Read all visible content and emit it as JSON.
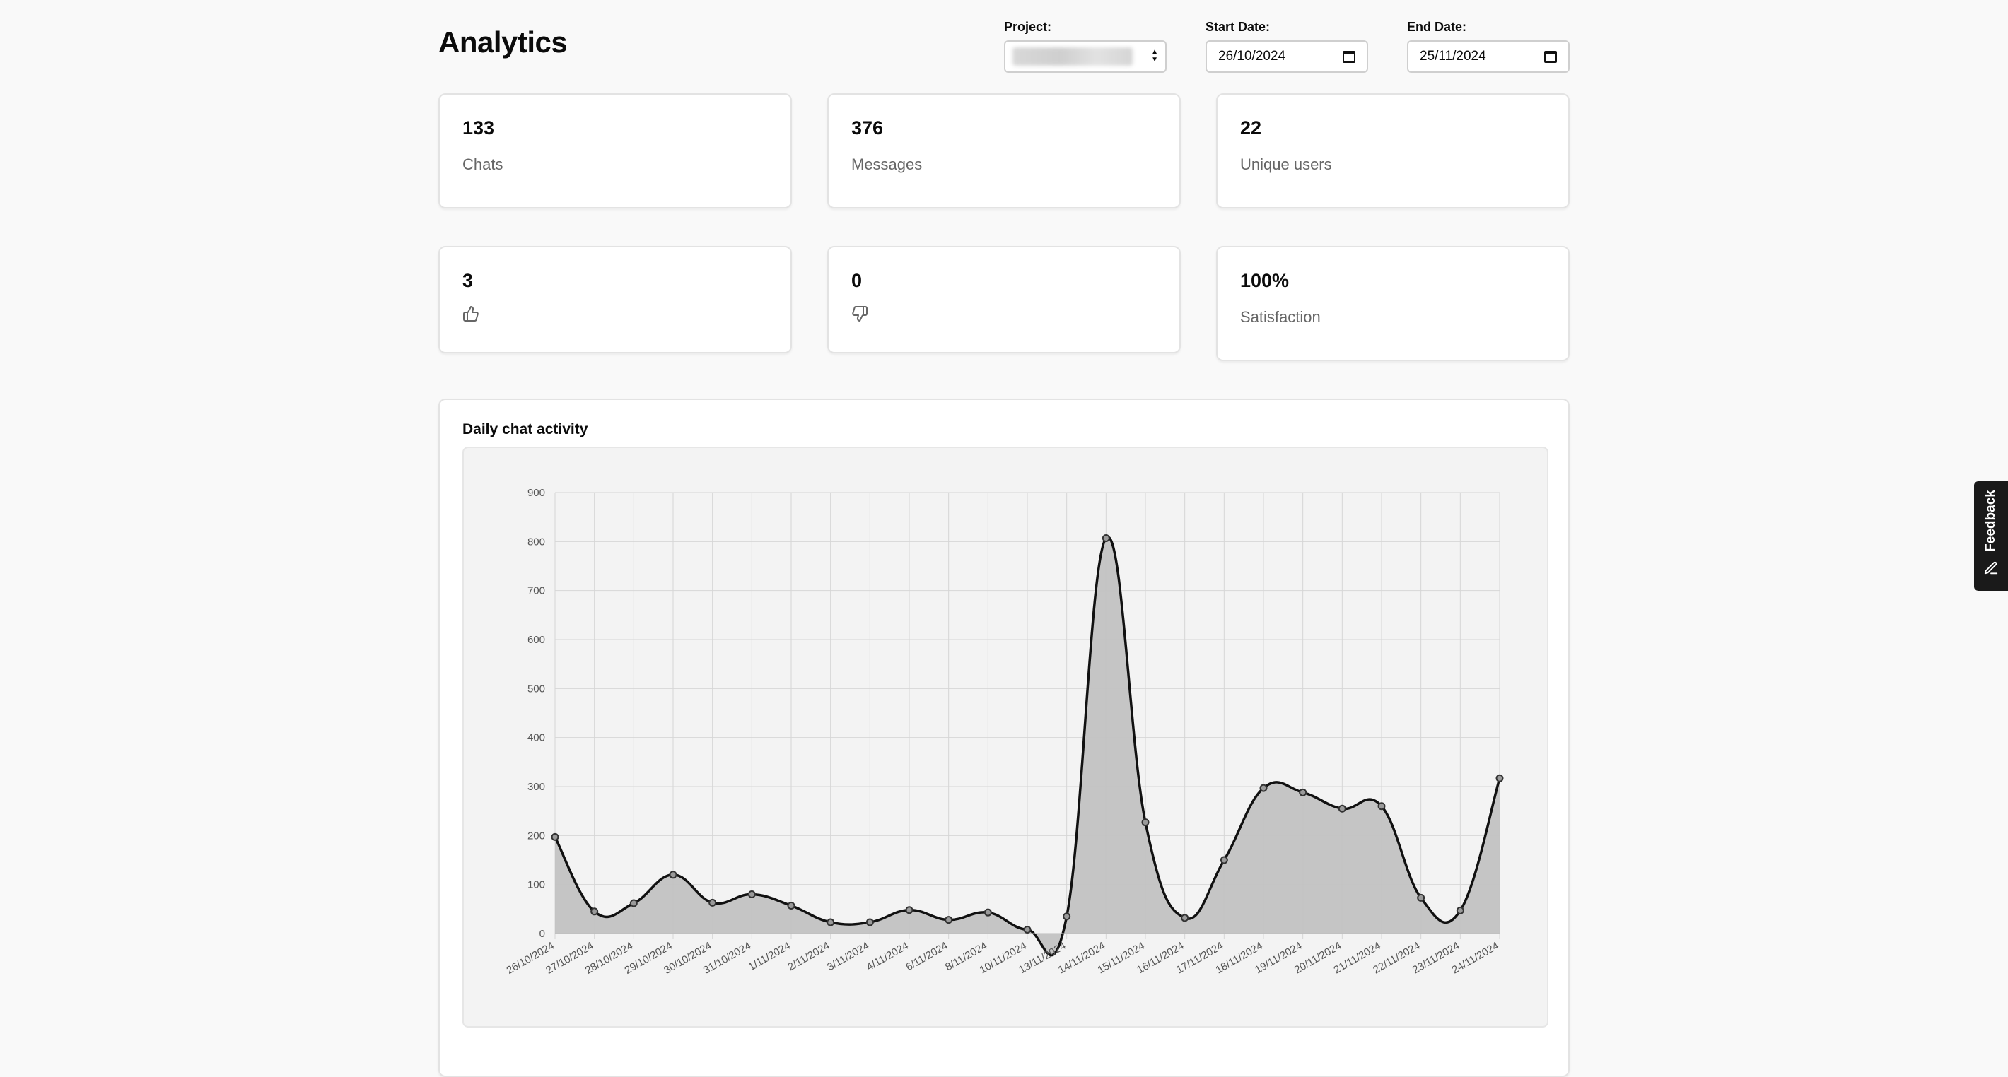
{
  "page_title": "Analytics",
  "filters": {
    "project_label": "Project:",
    "start_label": "Start Date:",
    "start_value": "26/10/2024",
    "end_label": "End Date:",
    "end_value": "25/11/2024"
  },
  "stats": {
    "chats": {
      "value": "133",
      "label": "Chats"
    },
    "messages": {
      "value": "376",
      "label": "Messages"
    },
    "unique_users": {
      "value": "22",
      "label": "Unique users"
    },
    "thumbs_up": {
      "value": "3",
      "icon": "thumbs-up-icon"
    },
    "thumbs_down": {
      "value": "0",
      "icon": "thumbs-down-icon"
    },
    "satisfaction": {
      "value": "100%",
      "label": "Satisfaction"
    }
  },
  "feedback_tab": {
    "label": "Feedback",
    "icon": "pencil-icon"
  },
  "chart_data": {
    "type": "area",
    "title": "Daily chat activity",
    "x": [
      "26/10/2024",
      "27/10/2024",
      "28/10/2024",
      "29/10/2024",
      "30/10/2024",
      "31/10/2024",
      "1/11/2024",
      "2/11/2024",
      "3/11/2024",
      "4/11/2024",
      "6/11/2024",
      "8/11/2024",
      "10/11/2024",
      "13/11/2024",
      "14/11/2024",
      "15/11/2024",
      "16/11/2024",
      "17/11/2024",
      "18/11/2024",
      "19/11/2024",
      "20/11/2024",
      "21/11/2024",
      "22/11/2024",
      "23/11/2024",
      "24/11/2024"
    ],
    "values": [
      197,
      45,
      62,
      120,
      63,
      80,
      57,
      23,
      23,
      48,
      28,
      43,
      8,
      35,
      807,
      227,
      32,
      150,
      297,
      288,
      255,
      260,
      73,
      47,
      317
    ],
    "ylim": [
      0,
      900
    ],
    "yticks": [
      0,
      100,
      200,
      300,
      400,
      500,
      600,
      700,
      800,
      900
    ],
    "grid": true,
    "colors": {
      "line": "#111111",
      "fill": "#c2c2c2",
      "grid": "#d6d6d6",
      "point": "#333333"
    }
  }
}
